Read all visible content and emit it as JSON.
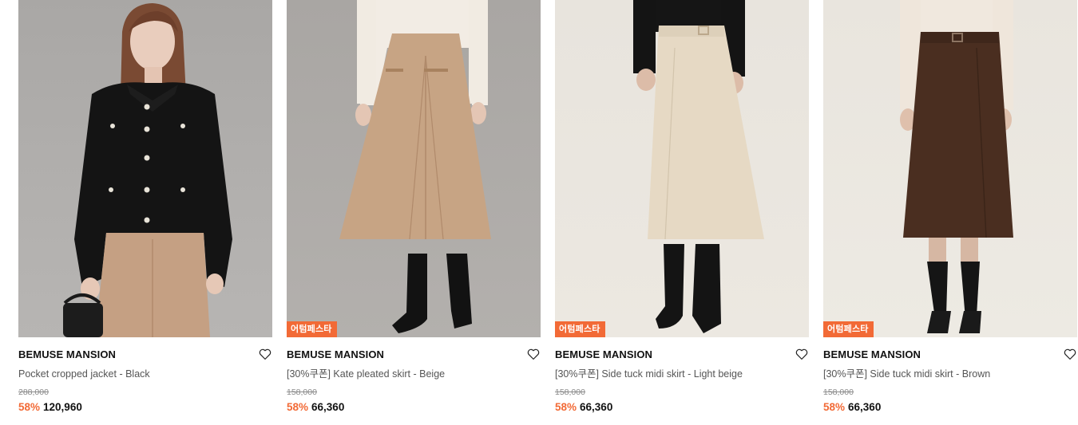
{
  "products": [
    {
      "brand": "BEMUSE MANSION",
      "name": "Pocket cropped jacket - Black",
      "original_price": "288,000",
      "discount": "58%",
      "price": "120,960",
      "badge": ""
    },
    {
      "brand": "BEMUSE MANSION",
      "name": "[30%쿠폰] Kate pleated skirt - Beige",
      "original_price": "158,000",
      "discount": "58%",
      "price": "66,360",
      "badge": "어텀페스타"
    },
    {
      "brand": "BEMUSE MANSION",
      "name": "[30%쿠폰] Side tuck midi skirt - Light beige",
      "original_price": "158,000",
      "discount": "58%",
      "price": "66,360",
      "badge": "어텀페스타"
    },
    {
      "brand": "BEMUSE MANSION",
      "name": "[30%쿠폰] Side tuck midi skirt - Brown",
      "original_price": "158,000",
      "discount": "58%",
      "price": "66,360",
      "badge": "어텀페스타"
    }
  ],
  "colors": {
    "accent": "#f26a36",
    "text": "#111111",
    "muted": "#555555"
  },
  "icons": {
    "wishlist": "heart-outline-icon"
  }
}
